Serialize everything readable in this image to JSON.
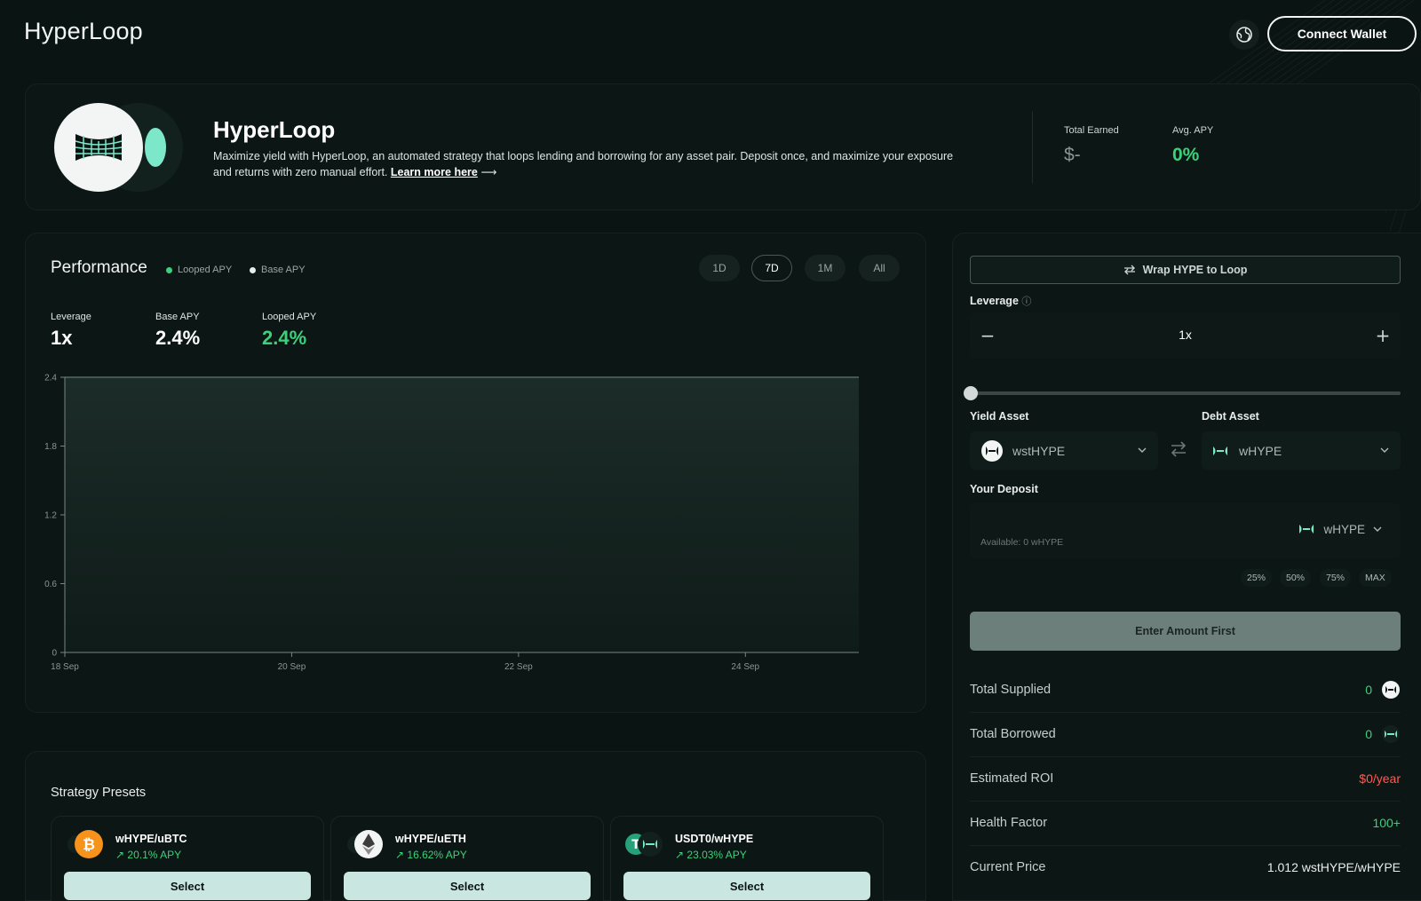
{
  "app": {
    "brand": "HyperLoop"
  },
  "header": {
    "connect_label": "Connect Wallet",
    "globe_icon": "globe-icon"
  },
  "hero": {
    "title": "HyperLoop",
    "description": "Maximize yield with HyperLoop, an automated strategy that loops lending and borrowing for any asset pair. Deposit once, and maximize your exposure and returns with zero manual effort.",
    "learn_more": "Learn more here",
    "arrow": "⟶",
    "total_earned_label": "Total Earned",
    "total_earned_value": "$-",
    "avg_apy_label": "Avg. APY",
    "avg_apy_value": "0%"
  },
  "performance": {
    "title": "Performance",
    "legend": [
      {
        "label": "Looped APY",
        "color": "#3bd17a"
      },
      {
        "label": "Base APY",
        "color": "#e8ecea"
      }
    ],
    "ranges": [
      "1D",
      "7D",
      "1M",
      "All"
    ],
    "active_range": "7D",
    "metrics": {
      "leverage_label": "Leverage",
      "leverage_value": "1x",
      "base_label": "Base APY",
      "base_value": "2.4%",
      "looped_label": "Looped APY",
      "looped_value": "2.4%"
    }
  },
  "chart_data": {
    "type": "area",
    "x": [
      "18 Sep",
      "19 Sep",
      "20 Sep",
      "21 Sep",
      "22 Sep",
      "23 Sep",
      "24 Sep",
      "25 Sep"
    ],
    "x_ticks": [
      "18 Sep",
      "20 Sep",
      "22 Sep",
      "24 Sep"
    ],
    "series": [
      {
        "name": "Looped APY",
        "values": [
          2.4,
          2.4,
          2.4,
          2.4,
          2.4,
          2.4,
          2.4,
          2.4
        ]
      },
      {
        "name": "Base APY",
        "values": [
          2.4,
          2.4,
          2.4,
          2.4,
          2.4,
          2.4,
          2.4,
          2.4
        ]
      }
    ],
    "y_ticks": [
      "0",
      "0.6",
      "1.2",
      "1.8",
      "2.4"
    ],
    "ylim": [
      0,
      2.4
    ],
    "grid": false,
    "legend": "top-left"
  },
  "presets": {
    "title": "Strategy Presets",
    "items": [
      {
        "name": "wHYPE/uBTC",
        "apy": "20.1% APY",
        "button": "Select",
        "icon": "bitcoin-icon"
      },
      {
        "name": "wHYPE/uETH",
        "apy": "16.62% APY",
        "button": "Select",
        "icon": "ethereum-icon"
      },
      {
        "name": "USDT0/wHYPE",
        "apy": "23.03% APY",
        "button": "Select",
        "icon": "usdt-icon"
      }
    ]
  },
  "panel": {
    "wrap_label": "Wrap HYPE to Loop",
    "leverage_label": "Leverage",
    "leverage_value": "1x",
    "minus": "−",
    "plus": "+",
    "slider_level": 0,
    "yield_asset_label": "Yield Asset",
    "yield_asset": "wstHYPE",
    "debt_asset_label": "Debt Asset",
    "debt_asset": "wHYPE",
    "deposit_label": "Your Deposit",
    "deposit_available": "Available: 0 wHYPE",
    "deposit_token": "wHYPE",
    "percent_buttons": [
      "25%",
      "50%",
      "75%",
      "MAX"
    ],
    "enter_button": "Enter Amount First",
    "rows": [
      {
        "label": "Total Supplied",
        "value": "0",
        "color": "#3bd17a"
      },
      {
        "label": "Total Borrowed",
        "value": "0",
        "color": "#3bd17a"
      },
      {
        "label": "Estimated ROI",
        "value": "$0/year",
        "color": "#ff5a52"
      },
      {
        "label": "Health Factor",
        "value": "100+",
        "color": "#3bd17a"
      },
      {
        "label": "Current Price",
        "value": "1.012 wstHYPE/wHYPE",
        "color": "#e8ecea"
      }
    ]
  },
  "colors": {
    "accent": "#3bd17a",
    "danger": "#ff5a52",
    "mint": "#c9e7e0",
    "background": "#0a1412"
  }
}
